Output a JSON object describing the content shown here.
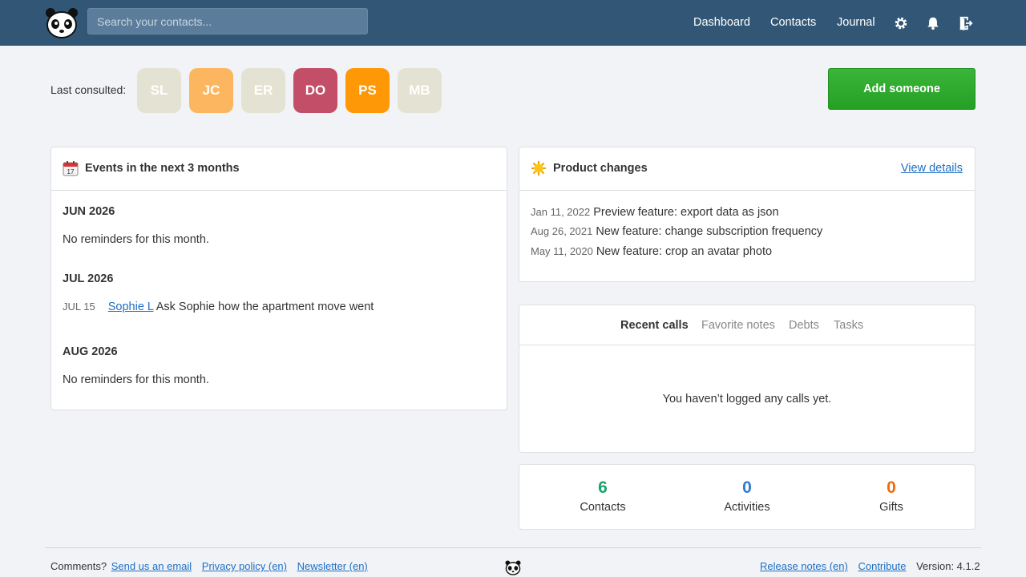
{
  "header": {
    "search_placeholder": "Search your contacts...",
    "nav": {
      "dashboard": "Dashboard",
      "contacts": "Contacts",
      "journal": "Journal"
    },
    "icons": [
      "gear-icon",
      "bell-icon",
      "logout-icon"
    ]
  },
  "last_consulted": {
    "label": "Last consulted:",
    "avatars": [
      {
        "initials": "SL",
        "color": "#e4e3d3"
      },
      {
        "initials": "JC",
        "color": "#fdb660"
      },
      {
        "initials": "ER",
        "color": "#e4e3d3"
      },
      {
        "initials": "DO",
        "color": "#c24e67"
      },
      {
        "initials": "PS",
        "color": "#ff9807"
      },
      {
        "initials": "MB",
        "color": "#e4e3d3"
      }
    ]
  },
  "add_button": "Add someone",
  "events": {
    "title": "Events in the next 3 months",
    "months": [
      {
        "name": "JUN 2026",
        "note": "No reminders for this month."
      },
      {
        "name": "JUL 2026",
        "date": "JUL 15",
        "contact": "Sophie L",
        "text": "Ask Sophie how the apartment move went"
      },
      {
        "name": "AUG 2026",
        "note": "No reminders for this month."
      }
    ]
  },
  "product_changes": {
    "title": "Product changes",
    "link": "View details",
    "items": [
      {
        "date": "Jan 11, 2022",
        "text": "Preview feature: export data as json"
      },
      {
        "date": "Aug 26, 2021",
        "text": "New feature: change subscription frequency"
      },
      {
        "date": "May 11, 2020",
        "text": "New feature: crop an avatar photo"
      }
    ]
  },
  "tabs": {
    "items": [
      "Recent calls",
      "Favorite notes",
      "Debts",
      "Tasks"
    ],
    "empty": "You haven’t logged any calls yet."
  },
  "stats": [
    {
      "value": "6",
      "label": "Contacts",
      "color": "#1aa36b"
    },
    {
      "value": "0",
      "label": "Activities",
      "color": "#2f7bd9"
    },
    {
      "value": "0",
      "label": "Gifts",
      "color": "#f06a0b"
    }
  ],
  "footer": {
    "comments": "Comments?",
    "email": "Send us an email",
    "privacy": "Privacy policy (en)",
    "newsletter": "Newsletter (en)",
    "release": "Release notes (en)",
    "contribute": "Contribute",
    "version": "Version: 4.1.2"
  }
}
